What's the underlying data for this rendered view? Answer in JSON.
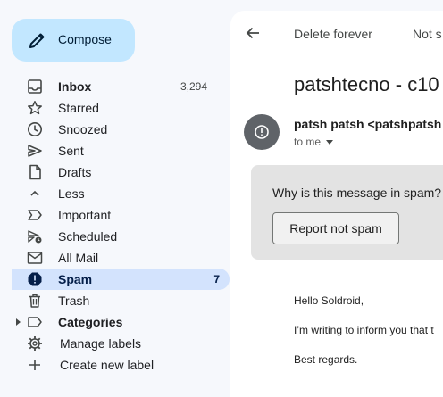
{
  "compose": {
    "label": "Compose",
    "icon": "pencil-icon"
  },
  "nav": {
    "inbox": {
      "label": "Inbox",
      "count": "3,294"
    },
    "starred": {
      "label": "Starred"
    },
    "snoozed": {
      "label": "Snoozed"
    },
    "sent": {
      "label": "Sent"
    },
    "drafts": {
      "label": "Drafts"
    },
    "less": {
      "label": "Less"
    },
    "important": {
      "label": "Important"
    },
    "scheduled": {
      "label": "Scheduled"
    },
    "all_mail": {
      "label": "All Mail"
    },
    "spam": {
      "label": "Spam",
      "count": "7"
    },
    "trash": {
      "label": "Trash"
    },
    "categories": {
      "label": "Categories"
    },
    "manage_labels": {
      "label": "Manage labels"
    },
    "create_label": {
      "label": "Create new label"
    }
  },
  "toolbar": {
    "delete_forever": "Delete forever",
    "not_spam": "Not s"
  },
  "message": {
    "subject": "patshtecno - c10",
    "sender": "patsh patsh <patshpatsh",
    "to": "to me",
    "spam_question": "Why is this message in spam?",
    "report_button": "Report not spam",
    "greeting": "Hello Soldroid,",
    "line1": "I’m writing to inform you that t",
    "closing": "Best regards."
  },
  "colors": {
    "compose_bg": "#c2e7ff",
    "active_bg": "#d3e3fd",
    "page_bg": "#f6f8fc",
    "spam_box_bg": "#e3e3e3"
  }
}
